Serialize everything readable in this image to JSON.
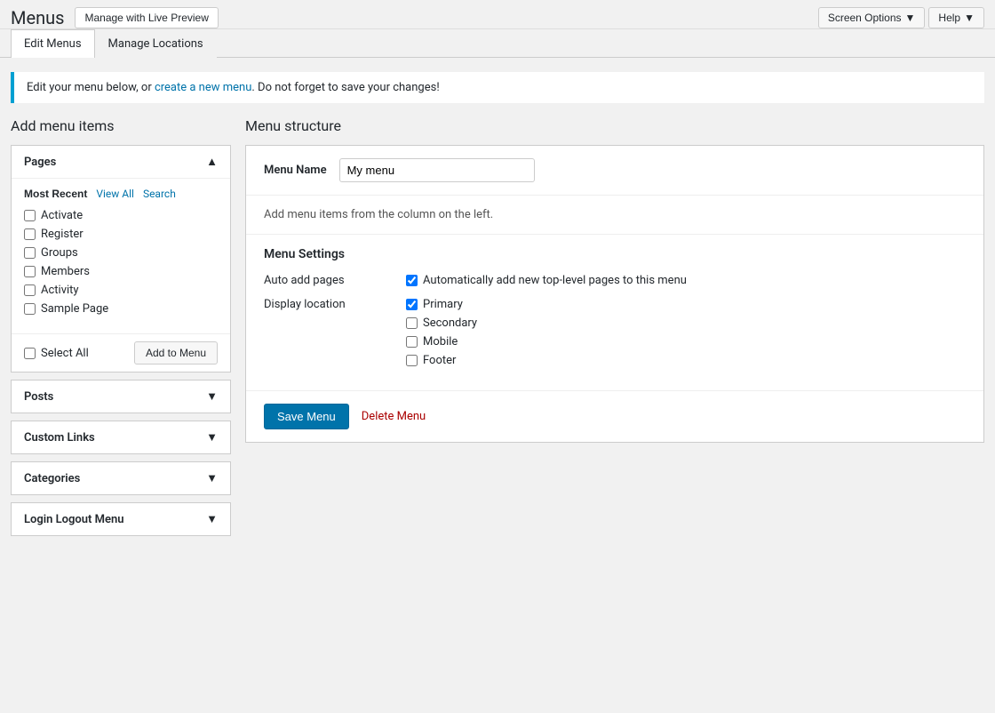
{
  "header": {
    "title": "Menus",
    "manage_live_preview_label": "Manage with Live Preview",
    "screen_options_label": "Screen Options",
    "help_label": "Help"
  },
  "tabs": [
    {
      "id": "edit-menus",
      "label": "Edit Menus",
      "active": true
    },
    {
      "id": "manage-locations",
      "label": "Manage Locations",
      "active": false
    }
  ],
  "notice": {
    "text_before": "Edit your menu below, or ",
    "link_text": "create a new menu",
    "text_after": ". Do not forget to save your changes!"
  },
  "left_panel": {
    "title": "Add menu items",
    "pages": {
      "label": "Pages",
      "sub_tabs": [
        {
          "id": "most-recent",
          "label": "Most Recent",
          "active": true
        },
        {
          "id": "view-all",
          "label": "View All",
          "active": false
        },
        {
          "id": "search",
          "label": "Search",
          "active": false
        }
      ],
      "items": [
        {
          "id": "activate",
          "label": "Activate",
          "checked": false
        },
        {
          "id": "register",
          "label": "Register",
          "checked": false
        },
        {
          "id": "groups",
          "label": "Groups",
          "checked": false
        },
        {
          "id": "members",
          "label": "Members",
          "checked": false
        },
        {
          "id": "activity",
          "label": "Activity",
          "checked": false
        },
        {
          "id": "sample-page",
          "label": "Sample Page",
          "checked": false
        }
      ],
      "select_all_label": "Select All",
      "add_to_menu_label": "Add to Menu"
    },
    "posts": {
      "label": "Posts",
      "expanded": false
    },
    "custom_links": {
      "label": "Custom Links",
      "expanded": false
    },
    "categories": {
      "label": "Categories",
      "expanded": false
    },
    "login_logout": {
      "label": "Login Logout Menu",
      "expanded": false
    }
  },
  "right_panel": {
    "title": "Menu structure",
    "menu_name_label": "Menu Name",
    "menu_name_value": "My menu",
    "menu_hint": "Add menu items from the column on the left.",
    "menu_settings": {
      "title": "Menu Settings",
      "auto_add_pages_label": "Auto add pages",
      "auto_add_pages_checked": true,
      "auto_add_pages_text": "Automatically add new top-level pages to this menu",
      "display_location_label": "Display location",
      "locations": [
        {
          "id": "primary",
          "label": "Primary",
          "checked": true
        },
        {
          "id": "secondary",
          "label": "Secondary",
          "checked": false
        },
        {
          "id": "mobile",
          "label": "Mobile",
          "checked": false
        },
        {
          "id": "footer",
          "label": "Footer",
          "checked": false
        }
      ]
    },
    "save_menu_label": "Save Menu",
    "delete_menu_label": "Delete Menu"
  }
}
